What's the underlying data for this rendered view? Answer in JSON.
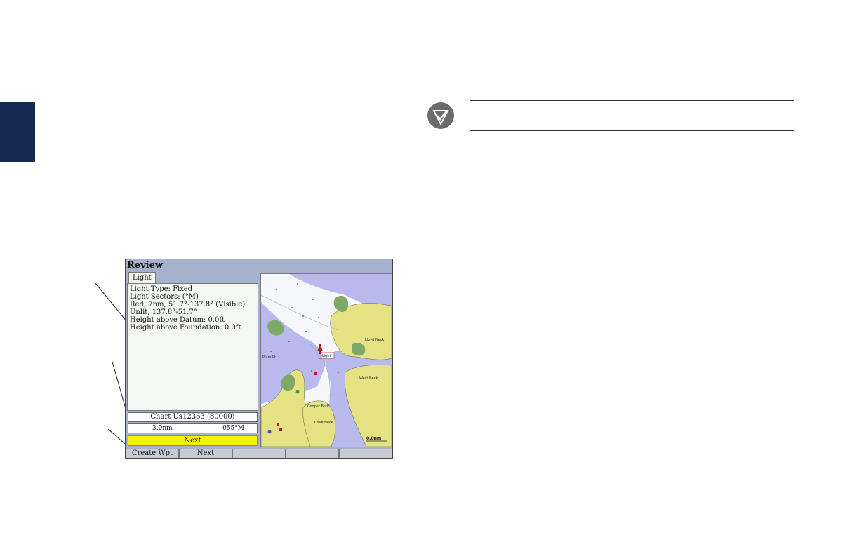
{
  "screen": {
    "title": "Review",
    "tab_label": "Light",
    "info_lines": [
      "Light Type: Fixed",
      "Light Sectors: (°M)",
      "Red, 7nm, 51.7°-137.8° (Visible)",
      "Unlit, 137.8°-51.7°",
      "Height above Datum: 0.0ft",
      "Height above Foundation: 0.0ft"
    ],
    "chart_label": "Chart Us12363 (80000)",
    "distance": "3.0nm",
    "bearing": "055°M",
    "next_button": "Next",
    "softkeys": [
      "Create Wpt",
      "Next",
      "",
      "",
      ""
    ]
  },
  "map": {
    "labels": {
      "light": "Light",
      "lloyd_neck": "Lloyd Neck",
      "west_neck": "West Neck",
      "cove_neck": "Cove Neck",
      "cooper_bluff": "Cooper Bluff",
      "plum_pt": "Plum Pt",
      "scale": "0.0nm"
    },
    "colors": {
      "water": "#b8b9ec",
      "deep_water": "#f6f7fb",
      "land": "#e5e283",
      "marsh": "#7ea867",
      "light_marker": "#b01c1c"
    }
  }
}
